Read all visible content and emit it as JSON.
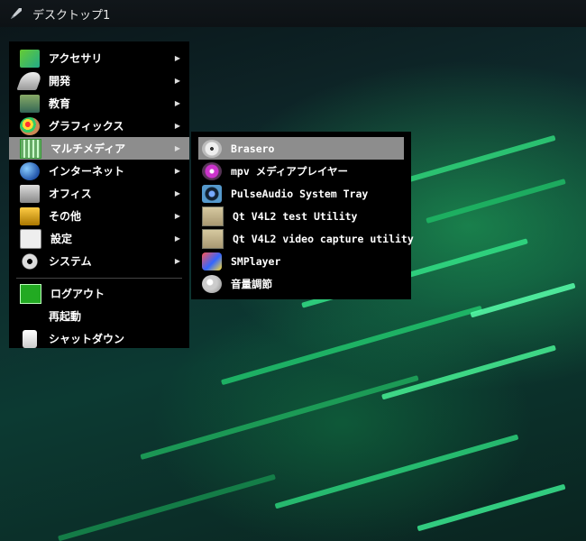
{
  "taskbar": {
    "desktop_name": "デスクトップ1",
    "launcher_icon": "rocket-icon"
  },
  "main_menu": {
    "items": [
      {
        "label": "アクセサリ",
        "icon": "accessories-icon",
        "has_submenu": true
      },
      {
        "label": "開発",
        "icon": "development-icon",
        "has_submenu": true
      },
      {
        "label": "教育",
        "icon": "education-icon",
        "has_submenu": true
      },
      {
        "label": "グラフィックス",
        "icon": "graphics-icon",
        "has_submenu": true
      },
      {
        "label": "マルチメディア",
        "icon": "multimedia-icon",
        "has_submenu": true,
        "selected": true
      },
      {
        "label": "インターネット",
        "icon": "internet-icon",
        "has_submenu": true
      },
      {
        "label": "オフィス",
        "icon": "office-icon",
        "has_submenu": true
      },
      {
        "label": "その他",
        "icon": "other-icon",
        "has_submenu": true
      },
      {
        "label": "設定",
        "icon": "settings-icon",
        "has_submenu": true
      },
      {
        "label": "システム",
        "icon": "system-icon",
        "has_submenu": true
      }
    ],
    "session_items": [
      {
        "label": "ログアウト",
        "icon": "logout-icon"
      },
      {
        "label": "再起動",
        "icon": ""
      },
      {
        "label": "シャットダウン",
        "icon": "shutdown-icon"
      }
    ],
    "submenu_arrow": "▶"
  },
  "sub_menu": {
    "items": [
      {
        "label": "Brasero",
        "icon": "brasero-icon",
        "selected": true
      },
      {
        "label": "mpv メディアプレイヤー",
        "icon": "mpv-icon"
      },
      {
        "label": "PulseAudio System Tray",
        "icon": "pulseaudio-icon"
      },
      {
        "label": "Qt V4L2 test Utility",
        "icon": "qt-v4l2-icon"
      },
      {
        "label": "Qt V4L2 video capture utility",
        "icon": "qt-v4l2-capture-icon"
      },
      {
        "label": "SMPlayer",
        "icon": "smplayer-icon"
      },
      {
        "label": "音量調節",
        "icon": "volume-control-icon"
      }
    ]
  },
  "colors": {
    "menu_bg": "#000000",
    "selected_bg": "#8d8d8d",
    "taskbar_bg": "#11161a"
  }
}
